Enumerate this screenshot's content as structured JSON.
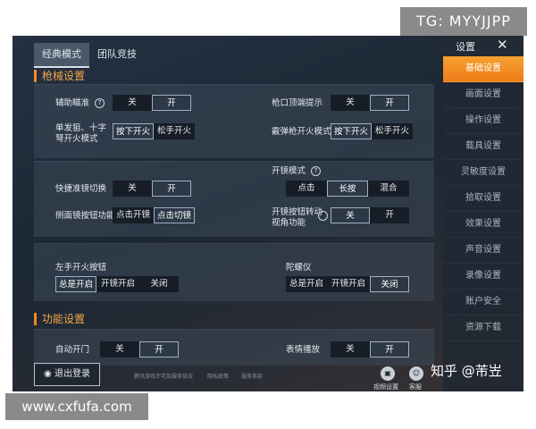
{
  "watermarks": {
    "top": "TG: MYYJJPP",
    "bottom": "www.cxfufa.com",
    "credit": "知乎 @芾岦"
  },
  "tabs": [
    "经典模式",
    "团队竞技"
  ],
  "sections": {
    "gun": "枪械设置",
    "func": "功能设置"
  },
  "labels": {
    "aim_assist": "辅助瞄准",
    "muzzle_hint": "枪口顶端提示",
    "single_fire": "单发狙、十字弩开火模式",
    "shotgun_fire": "霰弹枪开火模式",
    "quick_scope": "快捷准镜切换",
    "scope_mode": "开镜模式",
    "side_scope": "侧面镜按钮功能",
    "scope_rotate": "开镜按钮转动视角功能",
    "left_fire": "左手开火按钮",
    "gyro": "陀螺仪",
    "auto_door": "自动开门",
    "emote": "表情播放"
  },
  "options": {
    "off": "关",
    "on": "开",
    "press_fire": "按下开火",
    "release_fire": "松手开火",
    "tap": "点击",
    "hold": "长按",
    "mix": "混合",
    "tap_open": "点击开镜",
    "tap_switch": "点击切镜",
    "always_on": "总是开启",
    "scope_on": "开镜开启",
    "close": "关闭"
  },
  "sidebar": {
    "title": "设置",
    "close": "✕",
    "items": [
      "基础设置",
      "画面设置",
      "操作设置",
      "载具设置",
      "灵敏度设置",
      "拾取设置",
      "效果设置",
      "声音设置",
      "录像设置",
      "账户安全",
      "资源下载"
    ]
  },
  "footer": {
    "logout": "退出登录",
    "links": [
      "腾讯游戏许可及服务协议",
      "隐私政策",
      "服务条款"
    ],
    "icons": [
      "视频设置",
      "客服"
    ]
  }
}
